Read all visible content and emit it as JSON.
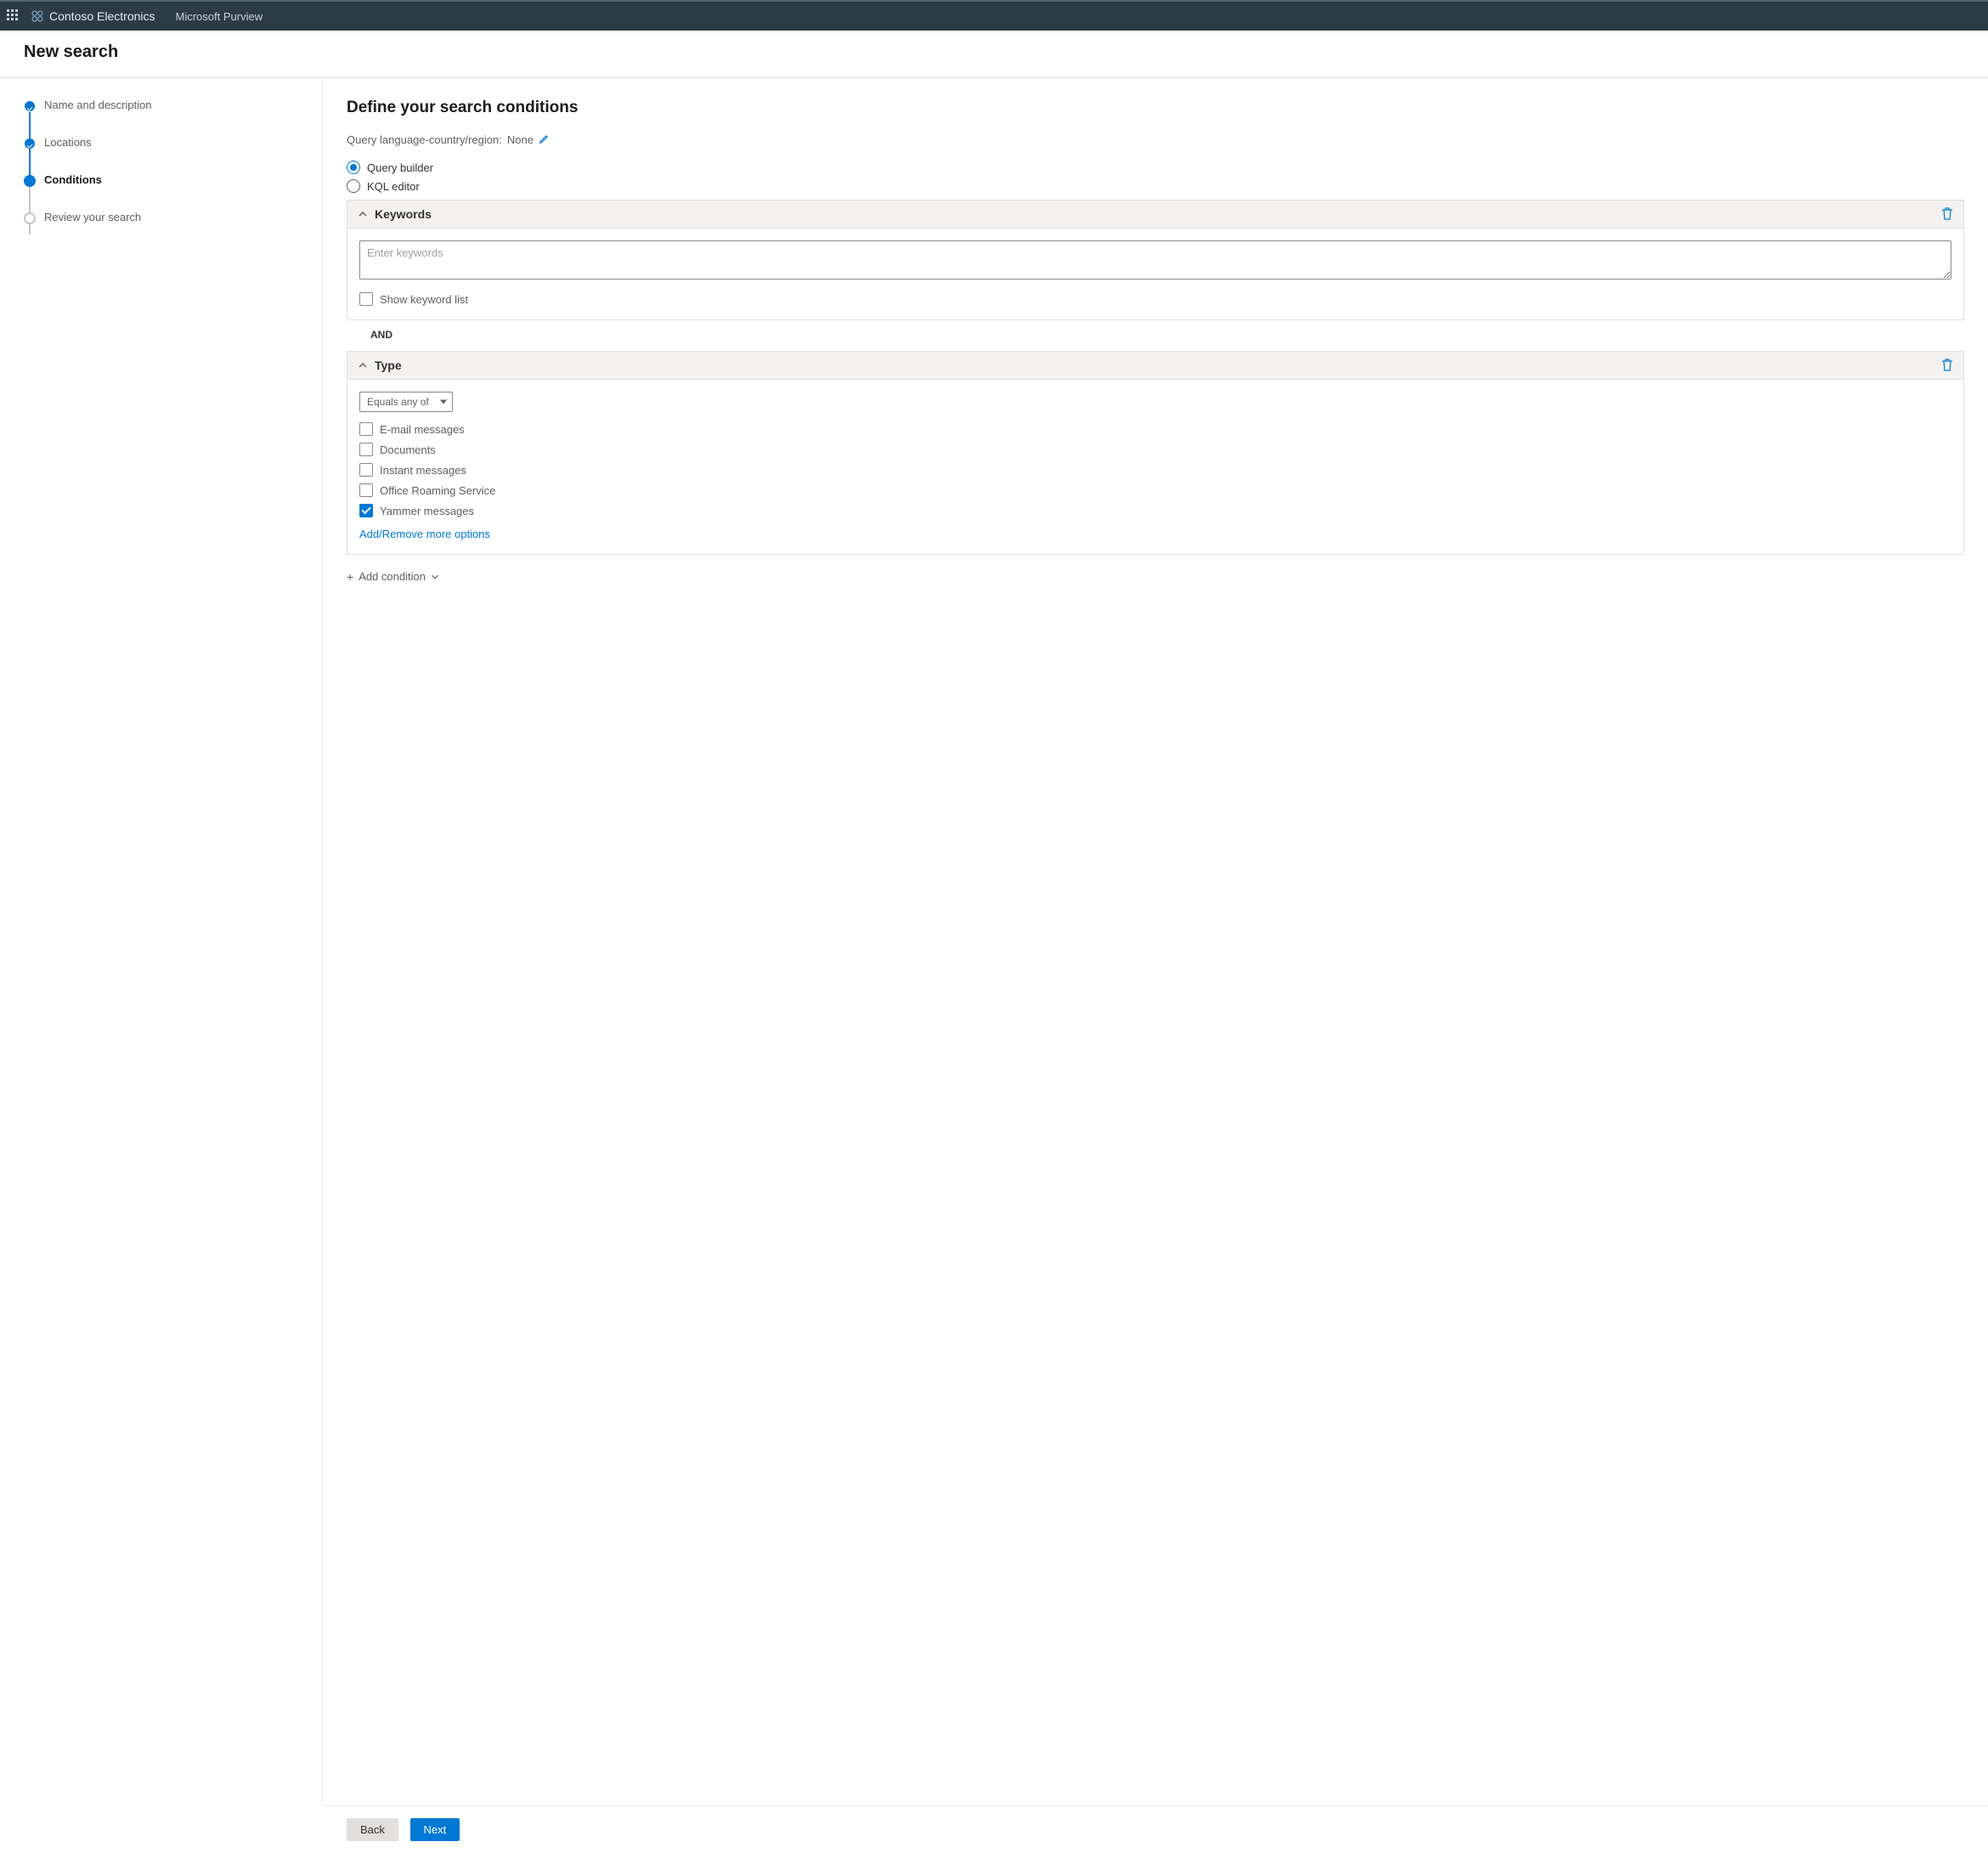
{
  "topbar": {
    "org_name": "Contoso Electronics",
    "product_name": "Microsoft Purview"
  },
  "page": {
    "title": "New search"
  },
  "stepper": {
    "steps": [
      {
        "label": "Name and description",
        "state": "done"
      },
      {
        "label": "Locations",
        "state": "done"
      },
      {
        "label": "Conditions",
        "state": "active"
      },
      {
        "label": "Review your search",
        "state": "upcoming"
      }
    ]
  },
  "main": {
    "heading": "Define your search conditions",
    "subline_prefix": "Query language-country/region:",
    "subline_value": "None",
    "radios": {
      "query_builder": "Query builder",
      "kql_editor": "KQL editor",
      "selected": "query_builder"
    },
    "keywords_panel": {
      "title": "Keywords",
      "placeholder": "Enter keywords",
      "show_keyword_list_label": "Show keyword list",
      "show_keyword_list_checked": false
    },
    "joiner": "AND",
    "type_panel": {
      "title": "Type",
      "operator": "Equals any of",
      "options": [
        {
          "label": "E-mail messages",
          "checked": false
        },
        {
          "label": "Documents",
          "checked": false
        },
        {
          "label": "Instant messages",
          "checked": false
        },
        {
          "label": "Office Roaming Service",
          "checked": false
        },
        {
          "label": "Yammer messages",
          "checked": true
        }
      ],
      "more_link": "Add/Remove more options"
    },
    "add_condition": "Add condition"
  },
  "footer": {
    "back": "Back",
    "next": "Next"
  }
}
